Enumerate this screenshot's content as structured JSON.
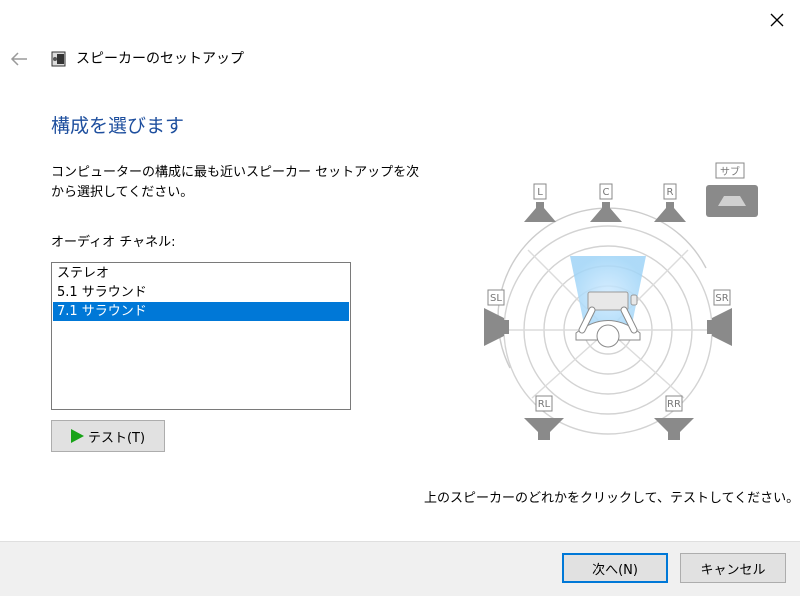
{
  "window": {
    "title": "スピーカーのセットアップ",
    "title_icon": "speaker-icon"
  },
  "heading": "構成を選びます",
  "description": "コンピューターの構成に最も近いスピーカー セットアップを次から選択してください。",
  "channels": {
    "label": "オーディオ チャネル:",
    "items": [
      "ステレオ",
      "5.1 サラウンド",
      "7.1 サラウンド"
    ],
    "selected": "7.1 サラウンド"
  },
  "test_button": {
    "label": "テスト(T)",
    "icon": "play-icon"
  },
  "speakers": {
    "L": "L",
    "C": "C",
    "R": "R",
    "SUB": "サブ",
    "SL": "SL",
    "SR": "SR",
    "RL": "RL",
    "RR": "RR"
  },
  "hint": "上のスピーカーのどれかをクリックして、テストしてください。",
  "footer": {
    "next": "次へ(N)",
    "cancel": "キャンセル"
  },
  "colors": {
    "accent": "#0078d7",
    "heading": "#1e4f9e",
    "play": "#17a317"
  }
}
